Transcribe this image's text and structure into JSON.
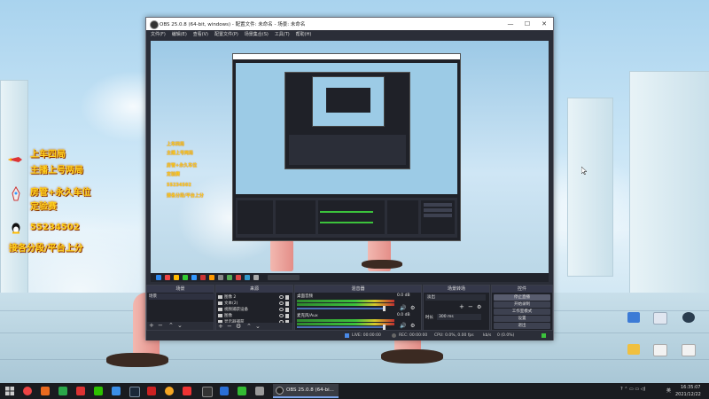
{
  "overlay": {
    "line1": "上车四局",
    "line2": "主播上号两局",
    "line3": "房管+永久车位",
    "line4": "定验赛",
    "qq": "55234502",
    "line5": "接各分段/平台上分"
  },
  "window": {
    "title": "OBS 25.0.8 (64-bit, windows) - 配置文件: 未命名 - 场景: 未命名",
    "minimize": "—",
    "maximize": "☐",
    "close": "✕"
  },
  "menu": [
    "文件(F)",
    "编辑(E)",
    "查看(V)",
    "配置文件(P)",
    "场景集合(S)",
    "工具(T)",
    "帮助(H)"
  ],
  "docks": {
    "scenes": {
      "title": "场景",
      "items": [
        "场景"
      ]
    },
    "sources": {
      "title": "来源",
      "items": [
        "图像 2",
        "文本(2)",
        "视频捕获设备",
        "图像",
        "显示器捕获"
      ]
    },
    "mixer": {
      "title": "混音器",
      "channels": [
        {
          "name": "桌面音频",
          "db": "0.0 dB"
        },
        {
          "name": "麦克风/Aux",
          "db": "0.0 dB"
        }
      ]
    },
    "transitions": {
      "title": "场景转场",
      "type": "淡出",
      "duration_label": "时长",
      "duration": "300 ms"
    },
    "controls": {
      "title": "控件",
      "buttons": [
        "停止直播",
        "开始录制",
        "工作室模式",
        "设置",
        "退出"
      ]
    }
  },
  "status": {
    "live": "LIVE: 00:00:00",
    "rec": "REC: 00:00:00",
    "cpu": "CPU: 0.0%, 0.00 fps",
    "kbps": "kb/s",
    "dropped": "0 (0.0%)"
  },
  "taskbar": {
    "obs_label": "OBS 25.0.8 (64-bi...",
    "time": "16:35:07",
    "date": "2021/12/22",
    "lang": "英"
  },
  "colors": {
    "overlay_text": "#ffd21e",
    "obs_bg": "#2b2e38",
    "taskbar": "#1a1c20"
  }
}
